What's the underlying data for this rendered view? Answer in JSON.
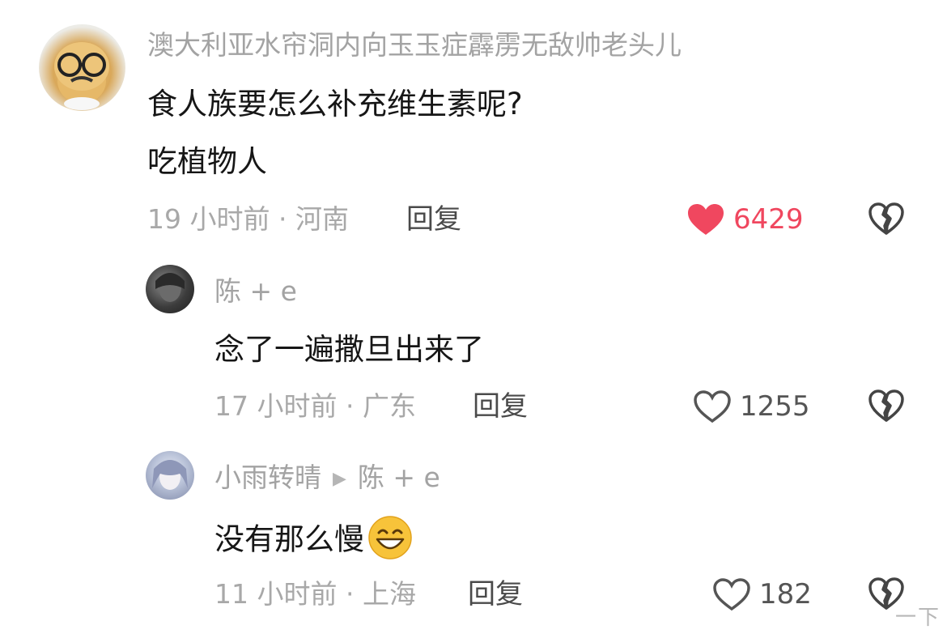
{
  "comments": [
    {
      "username": "澳大利亚水帘洞内向玉玉症霹雳无敌帅老头儿",
      "line1": "食人族要怎么补充维生素呢?",
      "line2": "吃植物人",
      "meta": "19 小时前 · 河南",
      "reply_label": "回复",
      "likes": "6429",
      "liked": true
    },
    {
      "username": "陈 + e",
      "text": "念了一遍撒旦出来了",
      "meta": "17 小时前 · 广东",
      "reply_label": "回复",
      "likes": "1255",
      "liked": false
    },
    {
      "username": "小雨转晴",
      "reply_to": "陈 + e",
      "text": "没有那么慢",
      "meta": "11 小时前 · 上海",
      "reply_label": "回复",
      "likes": "182",
      "liked": false
    }
  ],
  "colors": {
    "liked": "#f0475f",
    "meta": "#a8a8a8",
    "text": "#161616"
  },
  "icons": [
    "heart-filled-icon",
    "heart-outline-icon",
    "broken-heart-icon",
    "grinning-emoji-icon"
  ],
  "watermark": "一下"
}
